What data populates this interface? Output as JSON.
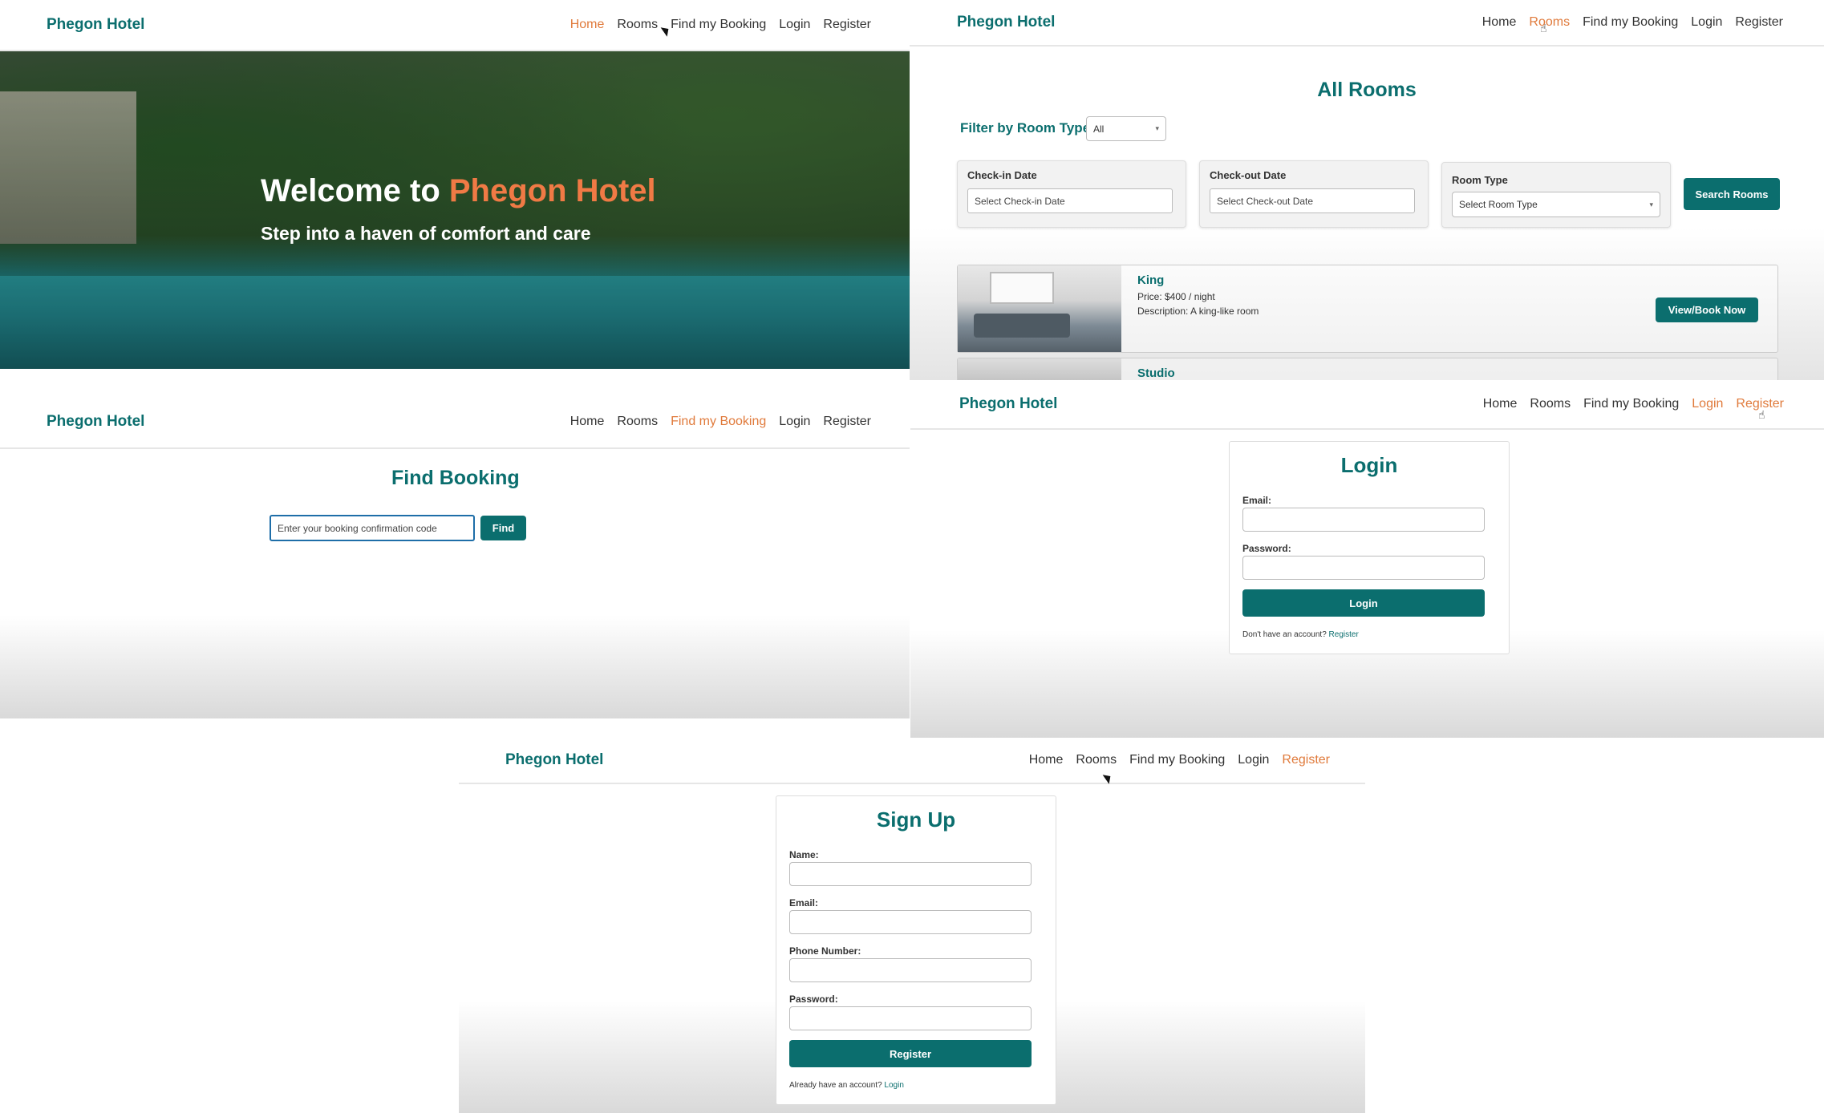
{
  "nav": {
    "brand": "Phegon Hotel",
    "home": "Home",
    "rooms": "Rooms",
    "find": "Find my Booking",
    "login": "Login",
    "register": "Register"
  },
  "hero": {
    "welcome": "Welcome to",
    "hotel": "Phegon Hotel",
    "subtitle": "Step into a haven of comfort and care"
  },
  "rooms_page": {
    "title": "All Rooms",
    "filter_label": "Filter by Room Type:",
    "filter_value": "All",
    "checkin_label": "Check-in Date",
    "checkin_placeholder": "Select Check-in Date",
    "checkout_label": "Check-out Date",
    "checkout_placeholder": "Select Check-out Date",
    "roomtype_label": "Room Type",
    "roomtype_placeholder": "Select Room Type",
    "search_button": "Search Rooms",
    "rooms": [
      {
        "name": "King",
        "price": "Price: $400 / night",
        "description": "Description: A king-like room",
        "button": "View/Book Now"
      },
      {
        "name": "Studio"
      }
    ]
  },
  "find_page": {
    "title": "Find Booking",
    "placeholder": "Enter your booking confirmation code",
    "button": "Find"
  },
  "login_page": {
    "title": "Login",
    "email_label": "Email:",
    "password_label": "Password:",
    "button": "Login",
    "note": "Don't have an account?",
    "note_link": "Register"
  },
  "signup_page": {
    "title": "Sign Up",
    "name_label": "Name:",
    "email_label": "Email:",
    "phone_label": "Phone Number:",
    "password_label": "Password:",
    "button": "Register",
    "note": "Already have an account?",
    "note_link": "Login"
  },
  "colors": {
    "brand": "#0b6e6e",
    "active_nav": "#e07a3b",
    "accent_title": "#f07a45"
  }
}
